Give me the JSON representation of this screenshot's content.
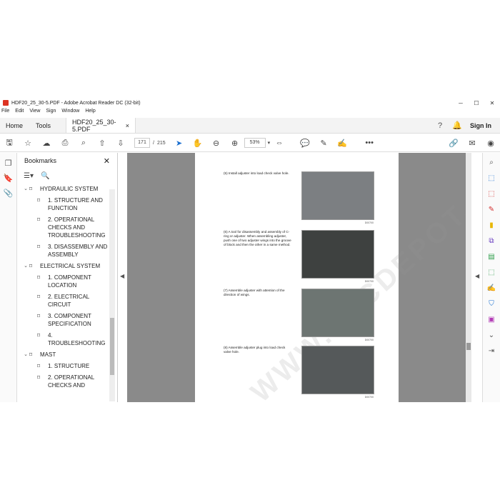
{
  "window": {
    "title": "HDF20_25_30-5.PDF - Adobe Acrobat Reader DC (32-bit)",
    "controls": [
      "─",
      "☐",
      "✕"
    ]
  },
  "menu": [
    "File",
    "Edit",
    "View",
    "Sign",
    "Window",
    "Help"
  ],
  "tabs": {
    "home": "Home",
    "tools": "Tools",
    "document": "HDF20_25_30-5.PDF",
    "document_close": "×",
    "sign_in": "Sign In"
  },
  "toolbar": {
    "current_page": "171",
    "page_separator": "/",
    "total_pages": "215",
    "zoom": "53%",
    "more": "•••"
  },
  "bookmarks": {
    "title": "Bookmarks",
    "close": "✕",
    "items": [
      {
        "label": "HYDRAULIC SYSTEM",
        "level": 0,
        "toggle": "⌄"
      },
      {
        "label": "1. STRUCTURE AND FUNCTION",
        "level": 1
      },
      {
        "label": "2. OPERATIONAL CHECKS AND TROUBLESHOOTING",
        "level": 1
      },
      {
        "label": "3. DISASSEMBLY AND ASSEMBLY",
        "level": 1
      },
      {
        "label": "ELECTRICAL SYSTEM",
        "level": 0,
        "toggle": "⌄"
      },
      {
        "label": "1. COMPONENT LOCATION",
        "level": 1
      },
      {
        "label": "2. ELECTRICAL CIRCUIT",
        "level": 1
      },
      {
        "label": "3. COMPONENT SPECIFICATION",
        "level": 1
      },
      {
        "label": "4. TROUBLESHOOTING",
        "level": 1
      },
      {
        "label": "MAST",
        "level": 0,
        "toggle": "⌄"
      },
      {
        "label": "1. STRUCTURE",
        "level": 1
      },
      {
        "label": "2. OPERATIONAL CHECKS AND",
        "level": 1
      }
    ]
  },
  "document": {
    "watermark": "WWW.EPCDEPOT.COM",
    "steps": [
      {
        "text": "(5)  Install adjuster into load check valve hole.",
        "code": "D00700",
        "photo_color": "#7c7f82"
      },
      {
        "text": "(6)  A tool for disassembly and assembly of C-ring or adjuster. When assembling adjuster, push one of two adjuster wings into the groove of block and then the other in a same method.",
        "code": "D00700",
        "photo_color": "#3e4140"
      },
      {
        "text": "(7)  Assemble adjuster with attention of the direction of wings.",
        "code": "D00700",
        "photo_color": "#6d7572"
      },
      {
        "text": "(8)  Assemble adjuster plug into load check valve hole.",
        "code": "D00700",
        "photo_color": "#55595a"
      }
    ]
  },
  "colors": {
    "accent": "#1a6fd0",
    "canvas": "#8a8a8a",
    "acrobat_red": "#d32f2f"
  }
}
